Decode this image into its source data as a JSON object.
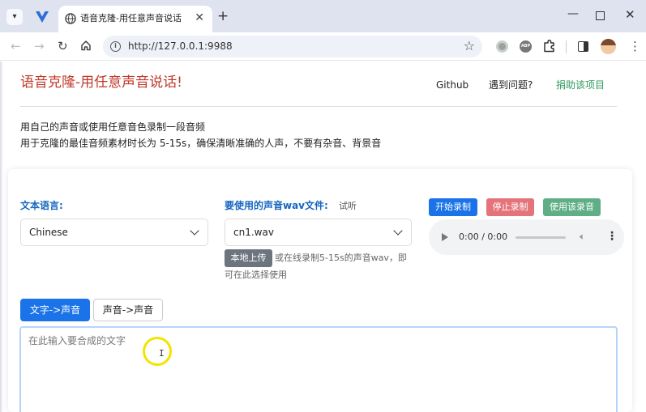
{
  "browser": {
    "tab_title": "语音克隆-用任意声音说话",
    "url": "http://127.0.0.1:9988",
    "new_tab": "+",
    "tab_close": "✕",
    "window_minimize": "—",
    "window_close": "✕",
    "ext_abp": "ABP"
  },
  "header": {
    "title": "语音克隆-用任意声音说话!",
    "links": [
      "Github",
      "遇到问题?",
      "捐助该项目"
    ],
    "link_support_color": "#2e9a5c",
    "title_color": "#c0392b"
  },
  "intro": {
    "line1": "用自己的声音或使用任意音色录制一段音频",
    "line2": "用于克隆的最佳音频素材时长为 5-15s，确保清晰准确的人声，不要有杂音、背景音"
  },
  "form": {
    "lang_label": "文本语言:",
    "lang_value": "Chinese",
    "wav_label": "要使用的声音wav文件:",
    "listen_label": "试听",
    "wav_value": "cn1.wav",
    "record_button": "开始录制",
    "stop_button": "停止录制",
    "use_button": "使用该录音",
    "audio_time": "0:00 / 0:00",
    "upload_button": "本地上传",
    "upload_hint_1": "或在线录制5-15s的声音wav，即",
    "upload_hint_2": "可在此选择使用",
    "accent_color": "#1a73e8"
  },
  "mode_tabs": {
    "tts": "文字->声音",
    "vc": "声音->声音"
  },
  "input": {
    "placeholder": "在此输入要合成的文字",
    "value": ""
  }
}
